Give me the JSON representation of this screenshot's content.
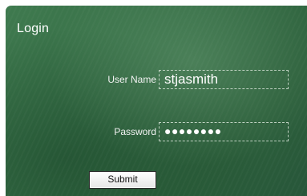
{
  "login": {
    "title": "Login",
    "username_label": "User Name",
    "username_value": "stjasmith",
    "password_label": "Password",
    "password_mask": "●●●●●●●●",
    "submit_label": "Submit"
  },
  "colors": {
    "panel_green": "#356d45",
    "text_white": "#ffffff",
    "button_face": "#f0f0f0"
  }
}
